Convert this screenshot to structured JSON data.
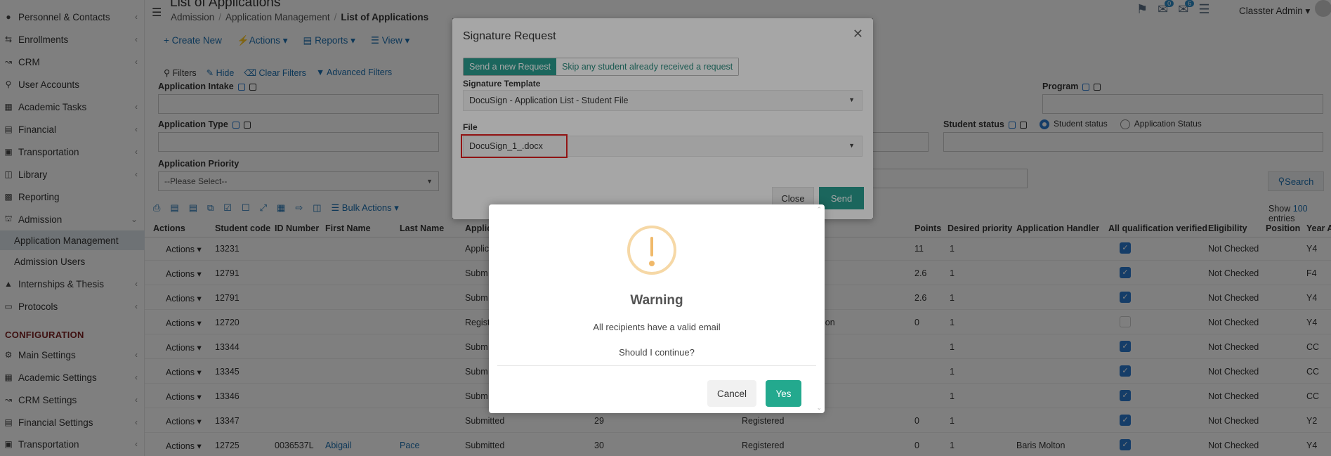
{
  "header": {
    "page_title": "List of Applications",
    "breadcrumb": [
      "Admission",
      "Application Management",
      "List of Applications"
    ],
    "user_name": "Classter Admin ▾",
    "notification_count": "0",
    "message_count": "6"
  },
  "sidebar": {
    "items": [
      {
        "label": "Personnel & Contacts",
        "icon": "person-icon"
      },
      {
        "label": "Enrollments",
        "icon": "arrows-icon"
      },
      {
        "label": "CRM",
        "icon": "crm-icon"
      },
      {
        "label": "User Accounts",
        "icon": "key-icon"
      },
      {
        "label": "Academic Tasks",
        "icon": "grid-icon"
      },
      {
        "label": "Financial",
        "icon": "money-icon"
      },
      {
        "label": "Transportation",
        "icon": "bus-icon"
      },
      {
        "label": "Library",
        "icon": "book-icon"
      },
      {
        "label": "Reporting",
        "icon": "chart-icon"
      },
      {
        "label": "Admission",
        "icon": "bank-icon"
      }
    ],
    "admission_sub": [
      "Application Management",
      "Admission Users"
    ],
    "items2": [
      {
        "label": "Internships & Thesis",
        "icon": "graduation-icon"
      },
      {
        "label": "Protocols",
        "icon": "folder-icon"
      }
    ],
    "config_heading": "CONFIGURATION",
    "config_items": [
      {
        "label": "Main Settings",
        "icon": "gear-icon"
      },
      {
        "label": "Academic Settings",
        "icon": "grid-icon"
      },
      {
        "label": "CRM Settings",
        "icon": "crm-icon"
      },
      {
        "label": "Financial Settings",
        "icon": "money-icon"
      },
      {
        "label": "Transportation",
        "icon": "bus-icon"
      }
    ]
  },
  "toolbar": {
    "create": "Create New",
    "actions": "Actions ▾",
    "reports": "Reports ▾",
    "view": "View ▾"
  },
  "filters": {
    "label": "Filters",
    "hide": "Hide",
    "clear": "Clear Filters",
    "advanced": "Advanced Filters",
    "application_intake": "Application Intake",
    "program": "Program",
    "application_type": "Application Type",
    "student_status": "Student status",
    "radio_student_status": "Student status",
    "radio_application_status": "Application Status",
    "application_priority": "Application Priority",
    "priority_placeholder": "--Please Select--",
    "search": "Search"
  },
  "bulk_actions": "Bulk Actions ▾",
  "show_entries": {
    "show": "Show",
    "count": "100",
    "entries": "entries"
  },
  "table": {
    "headers": [
      "Actions",
      "Student code",
      "ID Number",
      "First Name",
      "Last Name",
      "Applic",
      "Points",
      "Desired priority",
      "Application Handler",
      "All qualification verified",
      "Eligibility",
      "Position",
      "Year A"
    ],
    "rows": [
      {
        "actions": "Actions ▾",
        "code": "13231",
        "id": "",
        "first": "",
        "last": "",
        "status": "Applic",
        "col2": "",
        "col3": "",
        "points": "11",
        "priority": "1",
        "handler": "",
        "verified": true,
        "eligibility": "Not Checked",
        "year": "Y4"
      },
      {
        "actions": "Actions ▾",
        "code": "12791",
        "id": "",
        "first": "",
        "last": "",
        "status": "Subm",
        "col2": "",
        "col3": "",
        "points": "2.6",
        "priority": "1",
        "handler": "",
        "verified": true,
        "eligibility": "Not Checked",
        "year": "F4"
      },
      {
        "actions": "Actions ▾",
        "code": "12791",
        "id": "",
        "first": "",
        "last": "",
        "status": "Subm",
        "col2": "",
        "col3": "",
        "points": "2.6",
        "priority": "1",
        "handler": "",
        "verified": true,
        "eligibility": "Not Checked",
        "year": "Y4"
      },
      {
        "actions": "Actions ▾",
        "code": "12720",
        "id": "",
        "first": "",
        "last": "",
        "status": "Regist",
        "col2": "",
        "col3": "ion",
        "points": "0",
        "priority": "1",
        "handler": "",
        "verified": false,
        "eligibility": "Not Checked",
        "year": "Y4"
      },
      {
        "actions": "Actions ▾",
        "code": "13344",
        "id": "",
        "first": "",
        "last": "",
        "status": "Subm",
        "col2": "",
        "col3": "",
        "points": "",
        "priority": "1",
        "handler": "",
        "verified": true,
        "eligibility": "Not Checked",
        "year": "CC"
      },
      {
        "actions": "Actions ▾",
        "code": "13345",
        "id": "",
        "first": "",
        "last": "",
        "status": "Subm",
        "col2": "",
        "col3": "",
        "points": "",
        "priority": "1",
        "handler": "",
        "verified": true,
        "eligibility": "Not Checked",
        "year": "CC"
      },
      {
        "actions": "Actions ▾",
        "code": "13346",
        "id": "",
        "first": "",
        "last": "",
        "status": "Subm",
        "col2": "",
        "col3": "",
        "points": "",
        "priority": "1",
        "handler": "",
        "verified": true,
        "eligibility": "Not Checked",
        "year": "CC"
      },
      {
        "actions": "Actions ▾",
        "code": "13347",
        "id": "",
        "first": "",
        "last": "",
        "status": "Submitted",
        "col2": "29",
        "col3": "Registered",
        "points": "0",
        "priority": "1",
        "handler": "",
        "verified": true,
        "eligibility": "Not Checked",
        "year": "Y2"
      },
      {
        "actions": "Actions ▾",
        "code": "12725",
        "id": "0036537L",
        "first": "Abigail",
        "last": "Pace",
        "status": "Submitted",
        "col2": "30",
        "col3": "Registered",
        "points": "0",
        "priority": "1",
        "handler": "Baris Molton",
        "verified": true,
        "eligibility": "Not Checked",
        "year": "Y4"
      }
    ]
  },
  "signature_modal": {
    "title": "Signature Request",
    "tab_send": "Send a new Request",
    "tab_skip": "Skip any student already received a request",
    "template_label": "Signature Template",
    "template_value": "DocuSign - Application List - Student File",
    "file_label": "File",
    "file_value": "DocuSign_1_.docx",
    "close": "Close",
    "send": "Send"
  },
  "warning_dialog": {
    "title": "Warning",
    "message1": "All recipients have a valid email",
    "message2": "Should I continue?",
    "cancel": "Cancel",
    "yes": "Yes"
  },
  "colors": {
    "accent_teal": "#23a98e",
    "warning_orange": "#f0b96a",
    "highlight_red": "#e02020",
    "link_blue": "#1a6fb0"
  }
}
